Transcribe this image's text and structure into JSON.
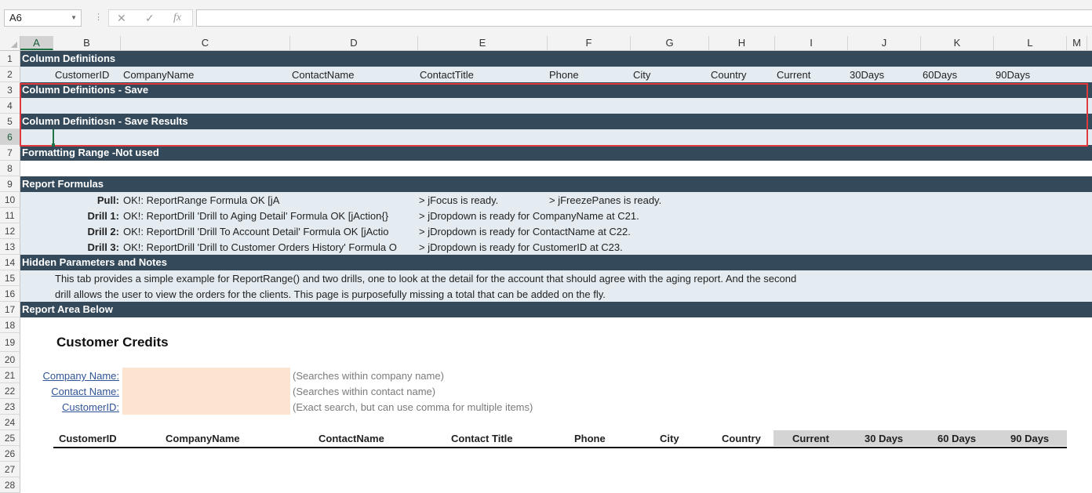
{
  "formula_bar": {
    "name_box": "A6",
    "cancel_icon": "✕",
    "enter_icon": "✓",
    "fx_label": "fx",
    "formula": ""
  },
  "columns": [
    "A",
    "B",
    "C",
    "D",
    "E",
    "F",
    "G",
    "H",
    "I",
    "J",
    "K",
    "L",
    "M"
  ],
  "selected_column": "A",
  "selected_row": "6",
  "rows": [
    "1",
    "2",
    "3",
    "4",
    "5",
    "6",
    "7",
    "8",
    "9",
    "10",
    "11",
    "12",
    "13",
    "14",
    "15",
    "16",
    "17",
    "18",
    "19",
    "20",
    "21",
    "22",
    "23",
    "24",
    "25",
    "26",
    "27",
    "28"
  ],
  "sections": {
    "r1": "Column Definitions",
    "r3": "Column Definitions - Save",
    "r5": "Column Definitiosn - Save Results",
    "r7": "Formatting Range -Not used",
    "r9": "Report Formulas",
    "r14": "Hidden Parameters and Notes",
    "r17": "Report Area Below"
  },
  "column_defs": [
    "CustomerID",
    "CompanyName",
    "ContactName",
    "ContactTitle",
    "Phone",
    "City",
    "Country",
    "Current",
    "30Days",
    "60Days",
    "90Days"
  ],
  "formulas": [
    {
      "label": "Pull:",
      "status": "OK!: ReportRange Formula OK [jA",
      "message": "> jFocus is ready.",
      "message2": "> jFreezePanes is ready."
    },
    {
      "label": "Drill 1:",
      "status": "OK!: ReportDrill 'Drill to Aging Detail' Formula OK [jAction{}",
      "message": "> jDropdown is ready for CompanyName at C21.",
      "message2": ""
    },
    {
      "label": "Drill 2:",
      "status": "OK!: ReportDrill 'Drill To Account Detail' Formula OK [jActio",
      "message": "> jDropdown is ready for ContactName at C22.",
      "message2": ""
    },
    {
      "label": "Drill 3:",
      "status": "OK!: ReportDrill 'Drill to Customer Orders History' Formula O",
      "message": "> jDropdown is ready for CustomerID at C23.",
      "message2": ""
    }
  ],
  "notes": {
    "line1": "This tab provides a simple example for ReportRange() and two drills, one to look at the detail for the account that should agree with the aging report. And the second",
    "line2": "drill allows the user to view the orders for the clients.   This page is purposefully missing a total that can be added on the fly."
  },
  "report": {
    "title": "Customer Credits",
    "filters": [
      {
        "label": "Company Name:",
        "value": "",
        "hint": "(Searches within company name)"
      },
      {
        "label": "Contact Name:",
        "value": "",
        "hint": "(Searches within contact name)"
      },
      {
        "label": "CustomerID:",
        "value": "",
        "hint": "(Exact search, but can use comma for multiple items)"
      }
    ],
    "headers": [
      "CustomerID",
      "CompanyName",
      "ContactName",
      "Contact Title",
      "Phone",
      "City",
      "Country",
      "Current",
      "30 Days",
      "60 Days",
      "90 Days"
    ]
  },
  "colors": {
    "section_bg": "#34495a",
    "band_bg": "#e4ecf1",
    "input_bg": "#fce4d0",
    "selection_border": "#e0393e",
    "excel_green": "#217346"
  }
}
